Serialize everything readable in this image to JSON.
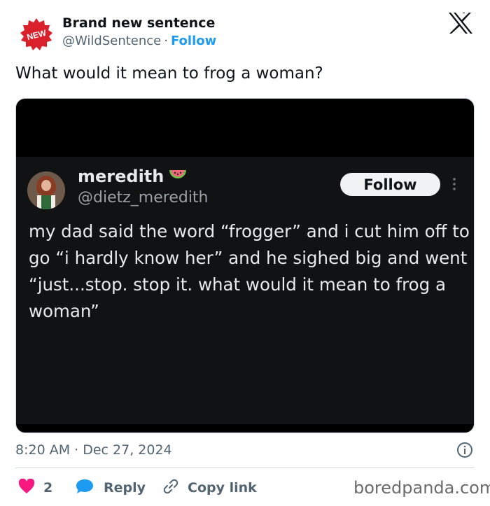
{
  "header": {
    "badge_text": "NEW",
    "author_name": "Brand new sentence",
    "handle": "@WildSentence",
    "separator": "·",
    "follow_label": "Follow",
    "logo": "x-logo"
  },
  "tweet": {
    "text": "What would it mean to frog a woman?"
  },
  "embedded_post": {
    "name": "meredith",
    "emoji": "watermelon-icon",
    "handle": "@dietz_meredith",
    "follow_label": "Follow",
    "body": "my dad said the word “frogger” and i cut him off to go “i hardly know her” and he sighed big and went “just...stop. stop it. what would it mean to frog a woman”"
  },
  "meta": {
    "timestamp": "8:20 AM · Dec 27, 2024"
  },
  "actions": {
    "like_count": "2",
    "reply_label": "Reply",
    "copy_label": "Copy link"
  },
  "watermark": "boredpanda.com",
  "colors": {
    "accent": "#1d9bf0",
    "like": "#f91880",
    "reply_icon": "#1d9bf0",
    "badge": "#d9202b"
  }
}
